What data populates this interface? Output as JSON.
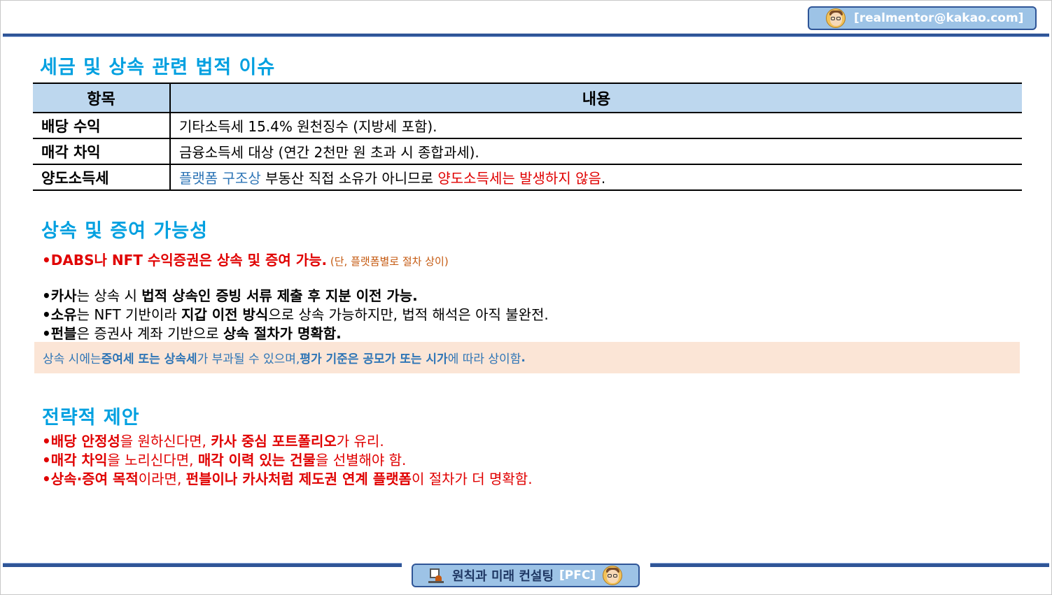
{
  "header": {
    "email": "[realmentor@kakao.com]"
  },
  "tax_section": {
    "title": "세금 및 상속 관련 법적 이슈",
    "columns": [
      "항목",
      "내용"
    ],
    "rows": [
      {
        "item": "배당 수익",
        "content": "기타소득세 15.4% 원천징수 (지방세 포함)."
      },
      {
        "item": "매각 차익",
        "content": "금융소득세 대상 (연간 2천만 원 초과 시 종합과세)."
      },
      {
        "item": "양도소득세",
        "content_blue": "플랫폼 구조상",
        "content_plain": " 부동산 직접 소유가 아니므로 ",
        "content_red": "양도소득세는 발생하지 않음",
        "content_end": "."
      }
    ]
  },
  "inherit_section": {
    "title": "상속 및 증여 가능성",
    "lead_bold": "•DABS나 NFT 수익증권은 상속 및 증여 가능.",
    "lead_note": " (단, 플랫폼별로 절차 상이)",
    "items": [
      {
        "name": "•카사",
        "t1": "는 상속 시 ",
        "b1": "법적 상속인 증빙 서류 제출 후 지분 이전 가능.",
        "t2": ""
      },
      {
        "name": "•소유",
        "t1": "는 NFT 기반이라 ",
        "b1": "지갑 이전 방식",
        "t2": "으로 상속 가능하지만, 법적 해석은 아직 불완전."
      },
      {
        "name": "•펀블",
        "t1": "은 증권사 계좌 기반으로 ",
        "b1": "상속 절차가 명확함.",
        "t2": ""
      }
    ],
    "callout": {
      "t1": "상속 시에는 ",
      "b1": "증여세 또는 상속세",
      "t2": "가 부과될 수 있으며, ",
      "b2": "평가 기준은 공모가 또는 시가",
      "t3": "에 따라 상이함",
      "b3": "."
    }
  },
  "strategy_section": {
    "title": "전략적 제안",
    "items": [
      {
        "b1": "•배당 안정성",
        "t1": "을 원하신다면, ",
        "b2": "카사 중심 포트폴리오",
        "t2": "가 유리."
      },
      {
        "b1": "•매각 차익",
        "t1": "을 노리신다면, ",
        "b2": "매각 이력 있는 건물",
        "t2": "을 선별해야 함."
      },
      {
        "b1": "•상속·증여 목적",
        "t1": "이라면, ",
        "b2": "펀블이나 카사처럼 제도권 연계 플랫폼",
        "t2": "이 절차가 더 명확함."
      }
    ]
  },
  "footer": {
    "title": "원칙과 미래 컨설팅",
    "tag": "[PFC]"
  },
  "colors": {
    "heading": "#00a0e0",
    "accent_blue": "#2e75b6",
    "accent_red": "#e00000",
    "bar": "#2f5597",
    "badge": "#9dc3e6",
    "table_header": "#bdd7ee",
    "callout_bg": "#fbe5d6"
  }
}
